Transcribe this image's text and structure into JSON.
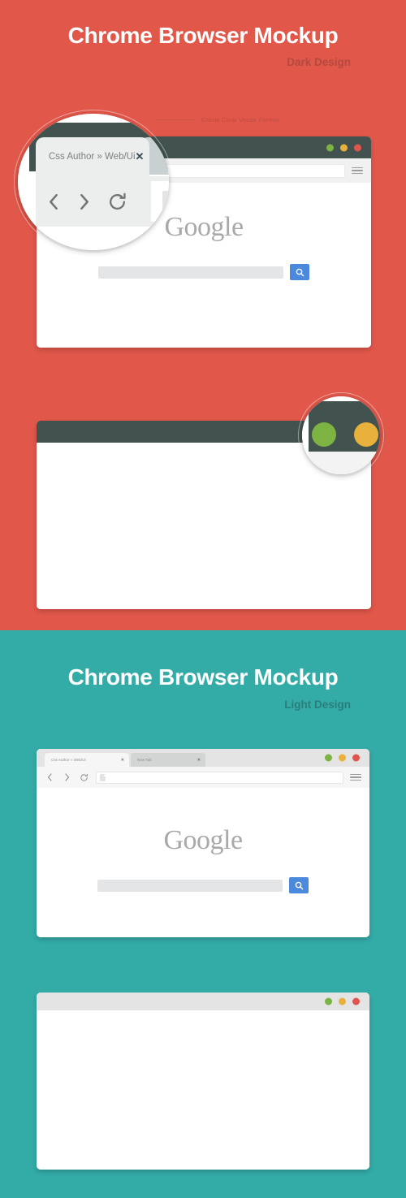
{
  "colors": {
    "dark_section_bg": "#e1574a",
    "light_section_bg": "#33aba7",
    "dark_titlebar": "#41524f",
    "light_titlebar": "#e3e4e3",
    "dot_green": "#7cb342",
    "dot_yellow": "#e8b13b",
    "dot_red": "#e0564f",
    "search_button_blue": "#4a89dc",
    "google_logo_grey": "#a9a9a9",
    "dark_subtitle": "#b4493f",
    "light_subtitle": "#2a7f7c",
    "annotation_text": "#bf4b41"
  },
  "dark_section": {
    "title": "Chrome Browser Mockup",
    "subtitle": "Dark Design",
    "annotation": "Cristal Clear Vector Format",
    "magnifier_tab": {
      "label": "Css Author  » Web/Ui",
      "close": "✕",
      "back_icon": "chevron-left-icon",
      "forward_icon": "chevron-right-icon",
      "reload_icon": "reload-icon",
      "page_icon": "page-icon"
    },
    "browser_one": {
      "dots": [
        "green",
        "yellow",
        "red"
      ],
      "url_value": "",
      "url_placeholder": "",
      "menu_icon": "hamburger-menu-icon",
      "page": {
        "logo": "Google",
        "search_value": "",
        "search_placeholder": "",
        "search_icon": "search-icon"
      }
    },
    "browser_two": {
      "dots": [
        "green",
        "yellow",
        "red"
      ],
      "page": ""
    }
  },
  "light_section": {
    "title": "Chrome Browser Mockup",
    "subtitle": "Light Design",
    "browser_one": {
      "tabs": [
        {
          "label": "Css Author » Web/Ui",
          "close": "✕",
          "active": true
        },
        {
          "label": "New Tab",
          "close": "✕",
          "active": false
        }
      ],
      "dots": [
        "green",
        "yellow",
        "red"
      ],
      "back_icon": "chevron-left-icon",
      "forward_icon": "chevron-right-icon",
      "reload_icon": "reload-icon",
      "favicon": "page-icon",
      "url_value": "",
      "url_placeholder": "",
      "menu_icon": "hamburger-menu-icon",
      "page": {
        "logo": "Google",
        "search_value": "",
        "search_placeholder": "",
        "search_icon": "search-icon"
      }
    },
    "browser_two": {
      "dots": [
        "green",
        "yellow",
        "red"
      ],
      "page": ""
    }
  }
}
